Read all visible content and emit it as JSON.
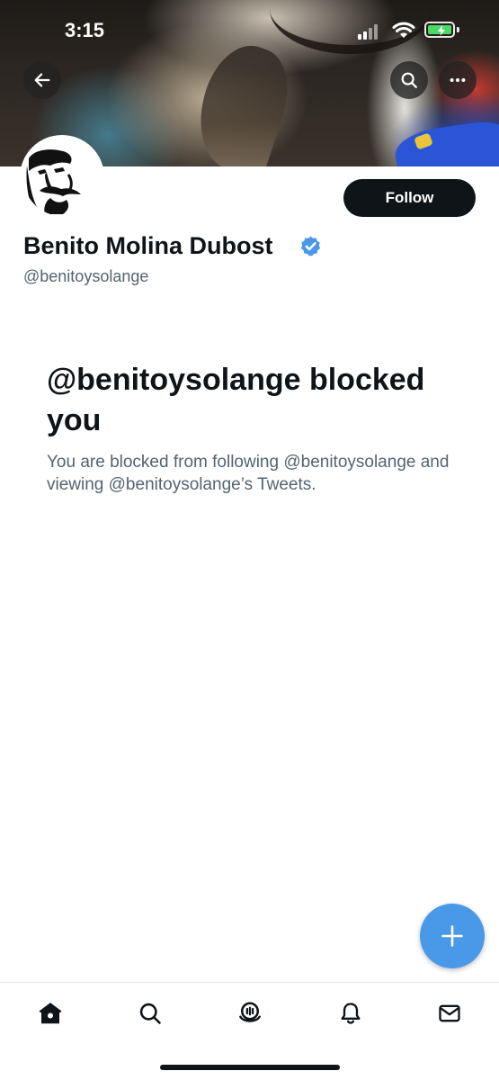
{
  "status_bar": {
    "time": "3:15",
    "battery_charging": true,
    "battery_color": "#4cd964"
  },
  "header": {
    "back_icon": "arrow-left-icon",
    "search_icon": "search-icon",
    "more_icon": "more-horizontal-icon"
  },
  "profile": {
    "display_name": "Benito Molina Dubost",
    "handle": "@benitoysolange",
    "verified": true,
    "verified_color": "#4a99e9",
    "follow_label": "Follow"
  },
  "blocked_notice": {
    "title": "@benitoysolange blocked you",
    "description": "You are blocked from following @benitoysolange and viewing @benitoysolange’s Tweets."
  },
  "fab": {
    "icon": "plus-icon",
    "color": "#4a99e9"
  },
  "bottom_nav": {
    "items": [
      {
        "name": "home",
        "icon": "home-icon",
        "active": true
      },
      {
        "name": "search",
        "icon": "search-icon"
      },
      {
        "name": "spaces",
        "icon": "spaces-icon"
      },
      {
        "name": "notifications",
        "icon": "bell-icon"
      },
      {
        "name": "messages",
        "icon": "mail-icon"
      }
    ]
  },
  "colors": {
    "text_primary": "#0f1419",
    "text_secondary": "#536471",
    "accent": "#4a99e9"
  }
}
